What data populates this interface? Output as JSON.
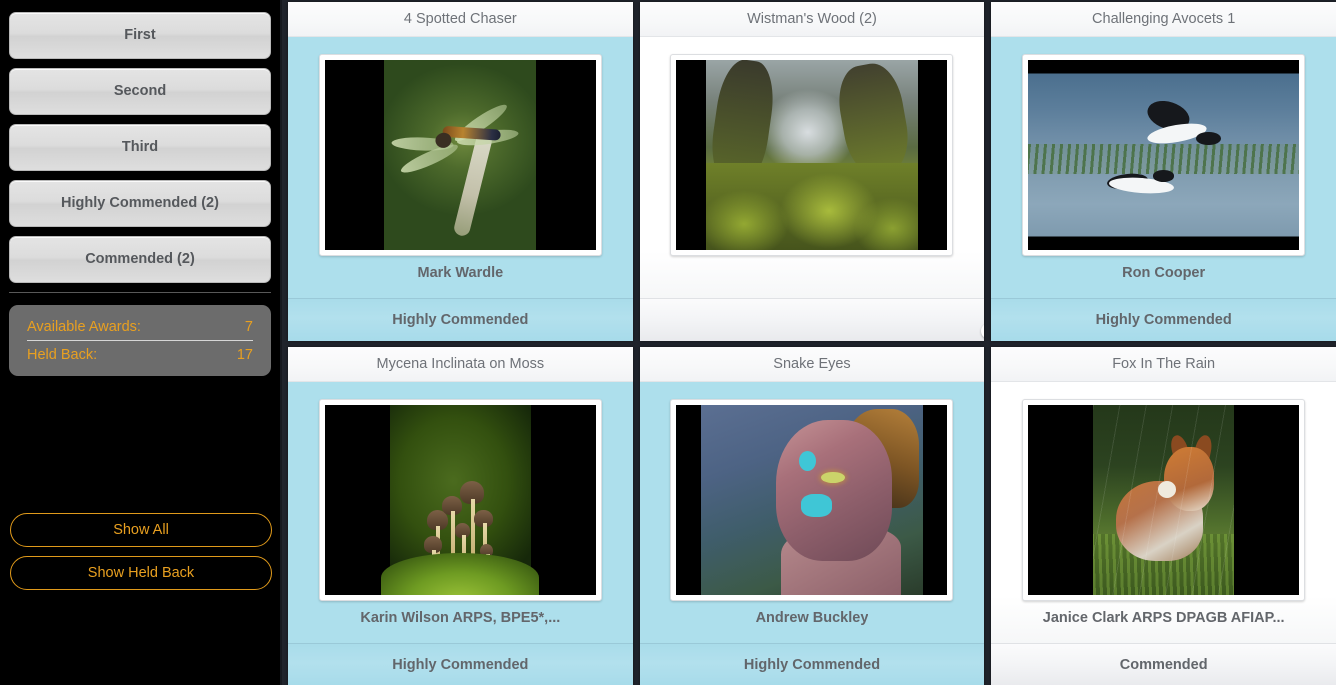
{
  "sidebar": {
    "award_buttons": [
      {
        "label": "First"
      },
      {
        "label": "Second"
      },
      {
        "label": "Third"
      },
      {
        "label": "Highly Commended (2)"
      },
      {
        "label": "Commended (2)"
      }
    ],
    "stats": {
      "available_awards_label": "Available Awards:",
      "available_awards_value": "7",
      "held_back_label": "Held Back:",
      "held_back_value": "17"
    },
    "actions": [
      {
        "label": "Show All"
      },
      {
        "label": "Show Held Back"
      }
    ],
    "colors": {
      "background": "#000000",
      "accent": "#e9a020",
      "panel": "#6c6c6c",
      "button_face": "#dcdcdc"
    }
  },
  "main": {
    "background": "#20242c",
    "card_blue": "#addfec",
    "toggle_on_color": "#0a8a0a",
    "cards": [
      {
        "title": "4 Spotted Chaser",
        "author": "Mark Wardle",
        "award": "Highly Commended",
        "body_style": "blue",
        "has_toggle": false,
        "photo": "dragonfly-on-flower-head"
      },
      {
        "title": "Wistman's Wood (2)",
        "author": "",
        "award": "",
        "body_style": "white",
        "has_toggle": true,
        "toggle_state": "on",
        "photo": "mossy-woodland"
      },
      {
        "title": "Challenging Avocets 1",
        "author": "Ron Cooper",
        "award": "Highly Commended",
        "body_style": "blue",
        "has_toggle": false,
        "photo": "avocets-in-water"
      },
      {
        "title": "Mycena Inclinata on Moss",
        "author": "Karin Wilson ARPS, BPE5*,...",
        "award": "Highly Commended",
        "body_style": "blue",
        "has_toggle": false,
        "photo": "mushrooms-on-moss"
      },
      {
        "title": "Snake Eyes",
        "author": "Andrew Buckley",
        "award": "Highly Commended",
        "body_style": "blue",
        "has_toggle": false,
        "photo": "body-painted-portrait"
      },
      {
        "title": "Fox In The Rain",
        "author": "Janice Clark ARPS DPAGB AFIAP...",
        "award": "Commended",
        "body_style": "white",
        "has_toggle": false,
        "photo": "fox-in-grass"
      }
    ]
  }
}
